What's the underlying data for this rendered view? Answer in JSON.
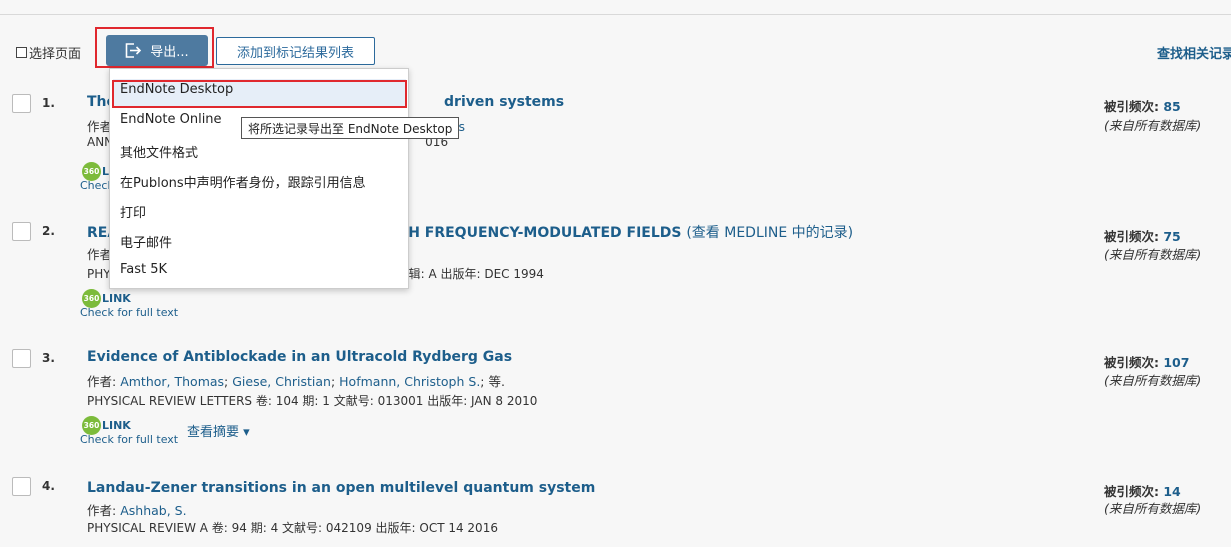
{
  "toolbar": {
    "select_page": "选择页面",
    "export_label": "导出...",
    "add_label": "添加到标记结果列表",
    "find_related": "查找相关记录"
  },
  "records": [
    {
      "num": "1.",
      "title": "The",
      "title_tail": "driven systems",
      "author_prefix": "作者",
      "author_tail": "is",
      "source_prefix": "ANN",
      "source_tail": "016",
      "link_badge": "360",
      "link_text": "L",
      "fulltext": "Check",
      "cite_label": "被引频次:",
      "cite_count": "85",
      "cite_src": "(来自所有数据库)"
    },
    {
      "num": "2.",
      "title": "REA",
      "title_tail": "H FREQUENCY-MODULATED FIELDS",
      "medline": "(查看 MEDLINE 中的记录)",
      "author_prefix": "作者",
      "source_prefix": "PHY",
      "source_tail": "子辑:  A   出版年:  DEC 1994",
      "link_badge": "360",
      "link_text": "LINK",
      "fulltext": "Check for full text",
      "cite_label": "被引频次:",
      "cite_count": "75",
      "cite_src": "(来自所有数据库)"
    },
    {
      "num": "3.",
      "title": "Evidence of Antiblockade in an Ultracold Rydberg Gas",
      "author_label": "作者:",
      "authors": [
        "Amthor, Thomas",
        "Giese, Christian",
        "Hofmann, Christoph S."
      ],
      "author_etc": "; 等.",
      "source": "PHYSICAL REVIEW LETTERS  卷: 104   期: 1    文献号: 013001   出版年:  JAN 8 2010",
      "link_badge": "360",
      "link_text": "LINK",
      "fulltext": "Check for full text",
      "abstract": "查看摘要 ▾",
      "cite_label": "被引频次:",
      "cite_count": "107",
      "cite_src": "(来自所有数据库)"
    },
    {
      "num": "4.",
      "title": "Landau-Zener transitions in an open multilevel quantum system",
      "author_label": "作者:",
      "authors": [
        "Ashhab, S."
      ],
      "source": "PHYSICAL REVIEW A   卷: 94    期: 4     文献号: 042109   出版年:  OCT 14 2016",
      "cite_label": "被引频次:",
      "cite_count": "14",
      "cite_src": "(来自所有数据库)"
    }
  ],
  "export_menu": {
    "items": [
      "EndNote Desktop",
      "EndNote Online",
      "其他文件格式",
      "在Publons中声明作者身份，跟踪引用信息",
      "打印",
      "电子邮件",
      "Fast 5K"
    ],
    "tooltip": "将所选记录导出至 EndNote Desktop"
  },
  "colors": {
    "accent": "#4e7aa0",
    "link": "#1d5e8b",
    "highlight_frame": "#e0282e",
    "badge": "#7cbb3b"
  }
}
